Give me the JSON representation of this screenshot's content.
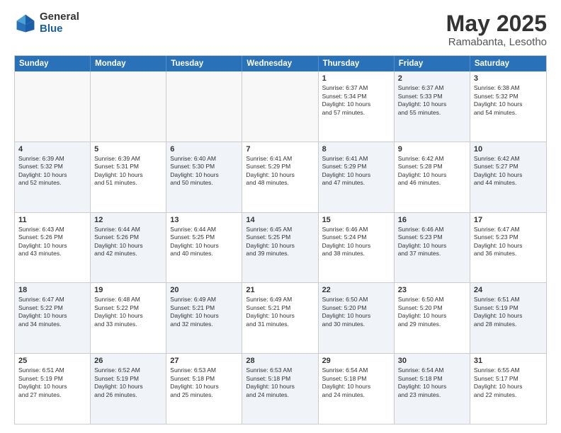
{
  "logo": {
    "general": "General",
    "blue": "Blue"
  },
  "title": "May 2025",
  "subtitle": "Ramabanta, Lesotho",
  "header_days": [
    "Sunday",
    "Monday",
    "Tuesday",
    "Wednesday",
    "Thursday",
    "Friday",
    "Saturday"
  ],
  "weeks": [
    [
      {
        "day": "",
        "info": "",
        "shaded": false,
        "empty": true
      },
      {
        "day": "",
        "info": "",
        "shaded": false,
        "empty": true
      },
      {
        "day": "",
        "info": "",
        "shaded": false,
        "empty": true
      },
      {
        "day": "",
        "info": "",
        "shaded": false,
        "empty": true
      },
      {
        "day": "1",
        "info": "Sunrise: 6:37 AM\nSunset: 5:34 PM\nDaylight: 10 hours\nand 57 minutes.",
        "shaded": false,
        "empty": false
      },
      {
        "day": "2",
        "info": "Sunrise: 6:37 AM\nSunset: 5:33 PM\nDaylight: 10 hours\nand 55 minutes.",
        "shaded": true,
        "empty": false
      },
      {
        "day": "3",
        "info": "Sunrise: 6:38 AM\nSunset: 5:32 PM\nDaylight: 10 hours\nand 54 minutes.",
        "shaded": false,
        "empty": false
      }
    ],
    [
      {
        "day": "4",
        "info": "Sunrise: 6:39 AM\nSunset: 5:32 PM\nDaylight: 10 hours\nand 52 minutes.",
        "shaded": true,
        "empty": false
      },
      {
        "day": "5",
        "info": "Sunrise: 6:39 AM\nSunset: 5:31 PM\nDaylight: 10 hours\nand 51 minutes.",
        "shaded": false,
        "empty": false
      },
      {
        "day": "6",
        "info": "Sunrise: 6:40 AM\nSunset: 5:30 PM\nDaylight: 10 hours\nand 50 minutes.",
        "shaded": true,
        "empty": false
      },
      {
        "day": "7",
        "info": "Sunrise: 6:41 AM\nSunset: 5:29 PM\nDaylight: 10 hours\nand 48 minutes.",
        "shaded": false,
        "empty": false
      },
      {
        "day": "8",
        "info": "Sunrise: 6:41 AM\nSunset: 5:29 PM\nDaylight: 10 hours\nand 47 minutes.",
        "shaded": true,
        "empty": false
      },
      {
        "day": "9",
        "info": "Sunrise: 6:42 AM\nSunset: 5:28 PM\nDaylight: 10 hours\nand 46 minutes.",
        "shaded": false,
        "empty": false
      },
      {
        "day": "10",
        "info": "Sunrise: 6:42 AM\nSunset: 5:27 PM\nDaylight: 10 hours\nand 44 minutes.",
        "shaded": true,
        "empty": false
      }
    ],
    [
      {
        "day": "11",
        "info": "Sunrise: 6:43 AM\nSunset: 5:26 PM\nDaylight: 10 hours\nand 43 minutes.",
        "shaded": false,
        "empty": false
      },
      {
        "day": "12",
        "info": "Sunrise: 6:44 AM\nSunset: 5:26 PM\nDaylight: 10 hours\nand 42 minutes.",
        "shaded": true,
        "empty": false
      },
      {
        "day": "13",
        "info": "Sunrise: 6:44 AM\nSunset: 5:25 PM\nDaylight: 10 hours\nand 40 minutes.",
        "shaded": false,
        "empty": false
      },
      {
        "day": "14",
        "info": "Sunrise: 6:45 AM\nSunset: 5:25 PM\nDaylight: 10 hours\nand 39 minutes.",
        "shaded": true,
        "empty": false
      },
      {
        "day": "15",
        "info": "Sunrise: 6:46 AM\nSunset: 5:24 PM\nDaylight: 10 hours\nand 38 minutes.",
        "shaded": false,
        "empty": false
      },
      {
        "day": "16",
        "info": "Sunrise: 6:46 AM\nSunset: 5:23 PM\nDaylight: 10 hours\nand 37 minutes.",
        "shaded": true,
        "empty": false
      },
      {
        "day": "17",
        "info": "Sunrise: 6:47 AM\nSunset: 5:23 PM\nDaylight: 10 hours\nand 36 minutes.",
        "shaded": false,
        "empty": false
      }
    ],
    [
      {
        "day": "18",
        "info": "Sunrise: 6:47 AM\nSunset: 5:22 PM\nDaylight: 10 hours\nand 34 minutes.",
        "shaded": true,
        "empty": false
      },
      {
        "day": "19",
        "info": "Sunrise: 6:48 AM\nSunset: 5:22 PM\nDaylight: 10 hours\nand 33 minutes.",
        "shaded": false,
        "empty": false
      },
      {
        "day": "20",
        "info": "Sunrise: 6:49 AM\nSunset: 5:21 PM\nDaylight: 10 hours\nand 32 minutes.",
        "shaded": true,
        "empty": false
      },
      {
        "day": "21",
        "info": "Sunrise: 6:49 AM\nSunset: 5:21 PM\nDaylight: 10 hours\nand 31 minutes.",
        "shaded": false,
        "empty": false
      },
      {
        "day": "22",
        "info": "Sunrise: 6:50 AM\nSunset: 5:20 PM\nDaylight: 10 hours\nand 30 minutes.",
        "shaded": true,
        "empty": false
      },
      {
        "day": "23",
        "info": "Sunrise: 6:50 AM\nSunset: 5:20 PM\nDaylight: 10 hours\nand 29 minutes.",
        "shaded": false,
        "empty": false
      },
      {
        "day": "24",
        "info": "Sunrise: 6:51 AM\nSunset: 5:19 PM\nDaylight: 10 hours\nand 28 minutes.",
        "shaded": true,
        "empty": false
      }
    ],
    [
      {
        "day": "25",
        "info": "Sunrise: 6:51 AM\nSunset: 5:19 PM\nDaylight: 10 hours\nand 27 minutes.",
        "shaded": false,
        "empty": false
      },
      {
        "day": "26",
        "info": "Sunrise: 6:52 AM\nSunset: 5:19 PM\nDaylight: 10 hours\nand 26 minutes.",
        "shaded": true,
        "empty": false
      },
      {
        "day": "27",
        "info": "Sunrise: 6:53 AM\nSunset: 5:18 PM\nDaylight: 10 hours\nand 25 minutes.",
        "shaded": false,
        "empty": false
      },
      {
        "day": "28",
        "info": "Sunrise: 6:53 AM\nSunset: 5:18 PM\nDaylight: 10 hours\nand 24 minutes.",
        "shaded": true,
        "empty": false
      },
      {
        "day": "29",
        "info": "Sunrise: 6:54 AM\nSunset: 5:18 PM\nDaylight: 10 hours\nand 24 minutes.",
        "shaded": false,
        "empty": false
      },
      {
        "day": "30",
        "info": "Sunrise: 6:54 AM\nSunset: 5:18 PM\nDaylight: 10 hours\nand 23 minutes.",
        "shaded": true,
        "empty": false
      },
      {
        "day": "31",
        "info": "Sunrise: 6:55 AM\nSunset: 5:17 PM\nDaylight: 10 hours\nand 22 minutes.",
        "shaded": false,
        "empty": false
      }
    ]
  ]
}
